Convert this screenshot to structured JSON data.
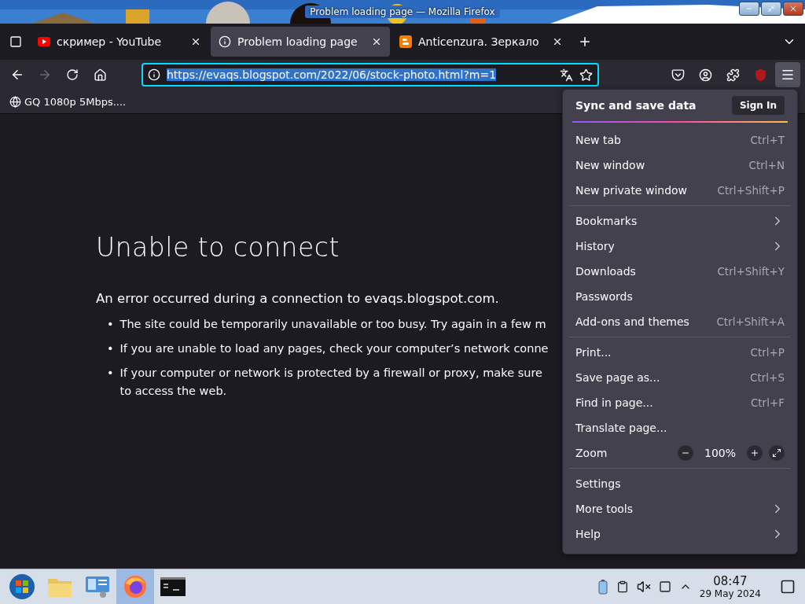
{
  "window": {
    "title": "Problem loading page — Mozilla Firefox"
  },
  "tabs": [
    {
      "label": "скример - YouTube",
      "selected": false
    },
    {
      "label": "Problem loading page",
      "selected": true
    },
    {
      "label": "Anticenzura. Зеркало",
      "selected": false
    }
  ],
  "url_bar": {
    "value": "https://evaqs.blogspot.com/2022/06/stock-photo.html?m=1",
    "highlighted": true
  },
  "bookmarks": [
    {
      "label": "GQ 1080p 5Mbps...."
    }
  ],
  "page": {
    "heading": "Unable to connect",
    "intro": "An error occurred during a connection to evaqs.blogspot.com.",
    "bullets": [
      {
        "marker": "•",
        "lines": [
          "The site could be temporarily unavailable or too busy. Try again in a few m"
        ]
      },
      {
        "marker": "•",
        "lines": [
          "If you are unable to load any pages, check your computer’s network conne"
        ]
      },
      {
        "marker": "•",
        "lines": [
          "If your computer or network is protected by a firewall or proxy, make sure",
          "to access the web."
        ]
      }
    ]
  },
  "menu": {
    "header": "Sync and save data",
    "sign_in": "Sign In",
    "groups": [
      [
        {
          "kind": "shortcut",
          "label": "New tab",
          "shortcut": "Ctrl+T"
        },
        {
          "kind": "shortcut",
          "label": "New window",
          "shortcut": "Ctrl+N"
        },
        {
          "kind": "shortcut",
          "label": "New private window",
          "shortcut": "Ctrl+Shift+P"
        }
      ],
      [
        {
          "kind": "submenu",
          "label": "Bookmarks"
        },
        {
          "kind": "submenu",
          "label": "History"
        },
        {
          "kind": "shortcut",
          "label": "Downloads",
          "shortcut": "Ctrl+Shift+Y"
        },
        {
          "kind": "plain",
          "label": "Passwords"
        },
        {
          "kind": "shortcut",
          "label": "Add-ons and themes",
          "shortcut": "Ctrl+Shift+A"
        }
      ],
      [
        {
          "kind": "shortcut",
          "label": "Print...",
          "shortcut": "Ctrl+P"
        },
        {
          "kind": "shortcut",
          "label": "Save page as...",
          "shortcut": "Ctrl+S"
        },
        {
          "kind": "shortcut",
          "label": "Find in page...",
          "shortcut": "Ctrl+F"
        },
        {
          "kind": "plain",
          "label": "Translate page..."
        },
        {
          "kind": "zoom",
          "label": "Zoom",
          "value": "100%"
        }
      ],
      [
        {
          "kind": "plain",
          "label": "Settings"
        },
        {
          "kind": "submenu",
          "label": "More tools"
        },
        {
          "kind": "submenu",
          "label": "Help"
        }
      ]
    ]
  },
  "taskbar": {
    "apps": [
      {
        "kind": "start",
        "selected": false
      },
      {
        "kind": "folder",
        "selected": false
      },
      {
        "kind": "panel",
        "selected": false
      },
      {
        "kind": "firefox",
        "selected": true
      },
      {
        "kind": "terminal",
        "selected": false
      }
    ],
    "time": "08:47",
    "date": "29 May 2024"
  }
}
